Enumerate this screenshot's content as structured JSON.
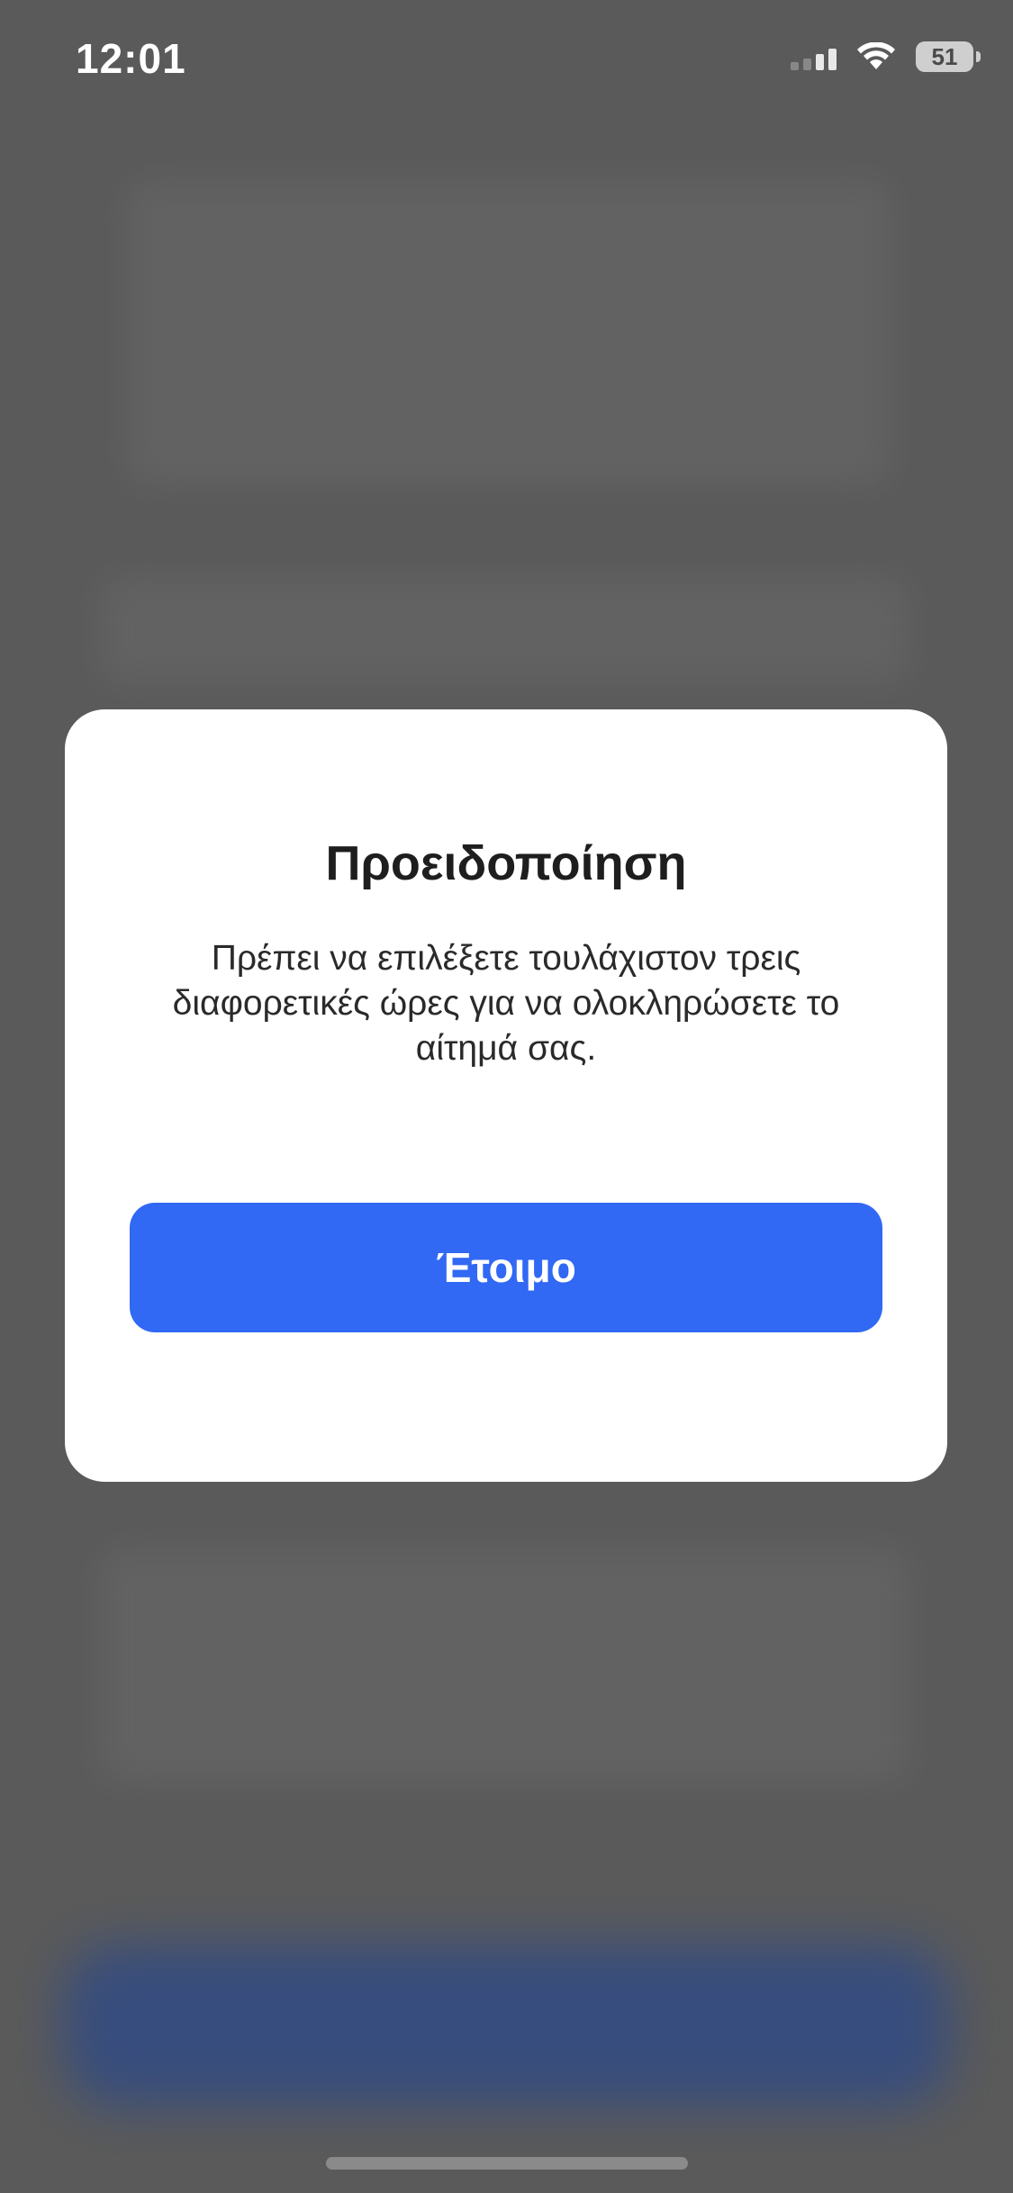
{
  "status_bar": {
    "time": "12:01",
    "battery_level": "51",
    "signal_icon": "cellular-signal-icon",
    "wifi_icon": "wifi-icon",
    "battery_icon": "battery-icon"
  },
  "alert": {
    "title": "Προειδοποίηση",
    "message": "Πρέπει να επιλέξετε τουλάχιστον τρεις διαφορετικές ώρες για να ολοκληρώσετε το αίτημά σας.",
    "button_label": "Έτοιμο"
  },
  "colors": {
    "overlay": "#5a5a5a",
    "primary_button": "#3168f4",
    "modal_background": "#ffffff"
  }
}
